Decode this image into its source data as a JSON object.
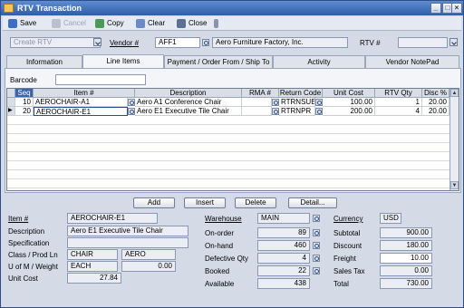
{
  "window": {
    "title": "RTV Transaction"
  },
  "toolbar": {
    "save": "Save",
    "cancel": "Cancel",
    "copy": "Copy",
    "clear": "Clear",
    "close": "Close"
  },
  "header": {
    "type_value": "Create RTV",
    "vendor_label": "Vendor #",
    "vendor_id": "AFF1",
    "vendor_name": "Aero Furniture Factory, Inc.",
    "rtv_label": "RTV #",
    "rtv_value": ""
  },
  "tabs": [
    "Information",
    "Line Items",
    "Payment / Order From / Ship To",
    "Activity",
    "Vendor NotePad"
  ],
  "barcode": {
    "label": "Barcode",
    "value": ""
  },
  "grid": {
    "columns": [
      "Seq",
      "Item #",
      "Description",
      "RMA #",
      "Return Code",
      "Unit Cost",
      "RTV Qty",
      "Disc %"
    ],
    "rows": [
      {
        "seq": "10",
        "item": "AEROCHAIR-A1",
        "desc": "Aero A1 Conference Chair",
        "rma": "",
        "code": "RTRNSUB",
        "cost": "100.00",
        "qty": "1",
        "disc": "20.00"
      },
      {
        "seq": "20",
        "item": "AEROCHAIR-E1",
        "desc": "Aero E1 Executive Tile Chair",
        "rma": "",
        "code": "RTRNPR",
        "cost": "200.00",
        "qty": "4",
        "disc": "20.00"
      }
    ]
  },
  "buttons": {
    "add": "Add",
    "insert": "Insert",
    "delete": "Delete",
    "detail": "Detail..."
  },
  "detail": {
    "item_label": "Item #",
    "item_value": "AEROCHAIR-E1",
    "desc_label": "Description",
    "desc_value": "Aero E1 Executive Tile Chair",
    "spec_label": "Specification",
    "spec_value": "",
    "class_label": "Class / Prod Ln",
    "class_value": "CHAIR",
    "prodln_value": "AERO",
    "uom_label": "U of M / Weight",
    "uom_value": "EACH",
    "weight_value": "0.00",
    "cost_label": "Unit Cost",
    "cost_value": "27.84"
  },
  "warehouse": {
    "wh_label": "Warehouse",
    "wh_value": "MAIN",
    "onorder_label": "On-order",
    "onorder_value": "89",
    "onhand_label": "On-hand",
    "onhand_value": "460",
    "defective_label": "Defective Qty",
    "defective_value": "4",
    "booked_label": "Booked",
    "booked_value": "22",
    "available_label": "Available",
    "available_value": "438"
  },
  "totals": {
    "currency_label": "Currency",
    "currency_value": "USD",
    "subtotal_label": "Subtotal",
    "subtotal_value": "900.00",
    "discount_label": "Discount",
    "discount_value": "180.00",
    "freight_label": "Freight",
    "freight_value": "10.00",
    "tax_label": "Sales Tax",
    "tax_value": "0.00",
    "total_label": "Total",
    "total_value": "730.00"
  }
}
